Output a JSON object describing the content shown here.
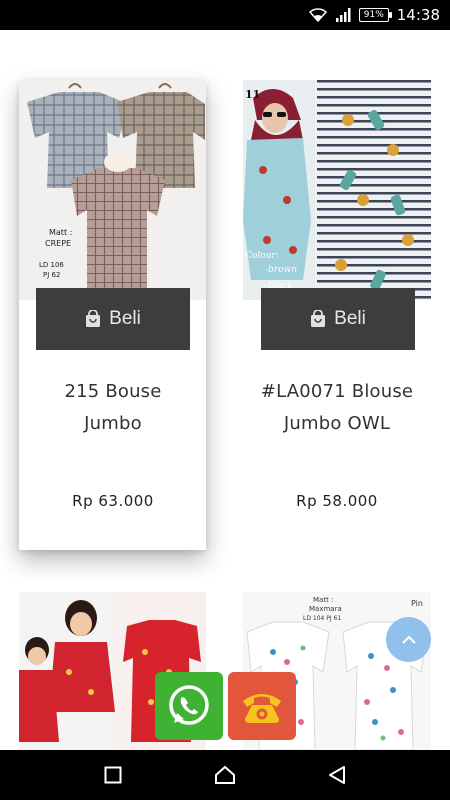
{
  "status_bar": {
    "time": "14:38",
    "battery": "91%",
    "wifi_icon": "wifi-icon",
    "signal_icon": "signal-icon"
  },
  "products": [
    {
      "title_line1": "215 Bouse",
      "title_line2": "Jumbo",
      "price": "Rp 63.000",
      "buy_label": "Beli",
      "image_caption_1": "Matt :",
      "image_caption_2": "CREPE",
      "image_caption_3": "LD 106",
      "image_caption_4": "PJ 62"
    },
    {
      "title_line1": "#LA0071 Blouse",
      "title_line2": "Jumbo OWL",
      "price": "Rp 58.000",
      "buy_label": "Beli",
      "image_caption_1": "Colour:",
      "image_caption_2": "-brown",
      "image_caption_3": "-black",
      "image_caption_4": "11"
    },
    {
      "image_caption_1": ""
    },
    {
      "image_caption_1": "Matt :",
      "image_caption_2": "Maxmara",
      "image_caption_3": "LD 104 PJ 61",
      "image_caption_4": "Pin"
    }
  ],
  "floating": {
    "scroll_top_icon": "chevron-up-icon",
    "whatsapp_icon": "whatsapp-icon",
    "phone_icon": "phone-icon"
  },
  "nav": {
    "recent_icon": "square-icon",
    "home_icon": "home-icon",
    "back_icon": "triangle-back-icon"
  },
  "colors": {
    "button_bg": "#3d3d3d",
    "whatsapp": "#3fb233",
    "phone": "#e2573c",
    "scroll_top": "#90c0ec"
  }
}
